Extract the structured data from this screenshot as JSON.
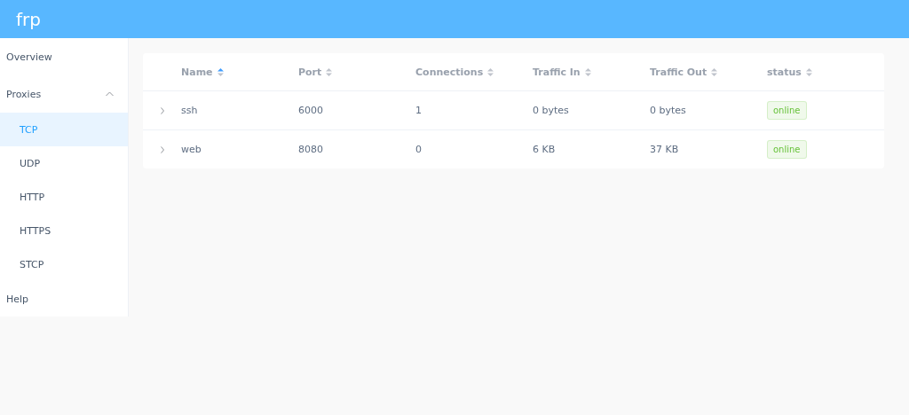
{
  "header": {
    "title": "frp"
  },
  "sidebar": {
    "items": [
      {
        "label": "Overview",
        "selected": false
      },
      {
        "label": "Proxies",
        "selected": false,
        "expanded": true,
        "children": [
          {
            "label": "TCP",
            "selected": true
          },
          {
            "label": "UDP",
            "selected": false
          },
          {
            "label": "HTTP",
            "selected": false
          },
          {
            "label": "HTTPS",
            "selected": false
          },
          {
            "label": "STCP",
            "selected": false
          }
        ]
      },
      {
        "label": "Help",
        "selected": false
      }
    ]
  },
  "table": {
    "columns": [
      {
        "label": "Name",
        "sorted": true
      },
      {
        "label": "Port",
        "sorted": false
      },
      {
        "label": "Connections",
        "sorted": false
      },
      {
        "label": "Traffic In",
        "sorted": false
      },
      {
        "label": "Traffic Out",
        "sorted": false
      },
      {
        "label": "status",
        "sorted": false
      }
    ],
    "rows": [
      {
        "expanded": false,
        "cells": [
          "ssh",
          "6000",
          "1",
          "0 bytes",
          "0 bytes"
        ],
        "status": "online",
        "color": "#67c23a"
      },
      {
        "expanded": false,
        "cells": [
          "web",
          "8080",
          "0",
          "6 KB",
          "37 KB"
        ],
        "status": "online",
        "color": "#67c23a"
      }
    ]
  }
}
